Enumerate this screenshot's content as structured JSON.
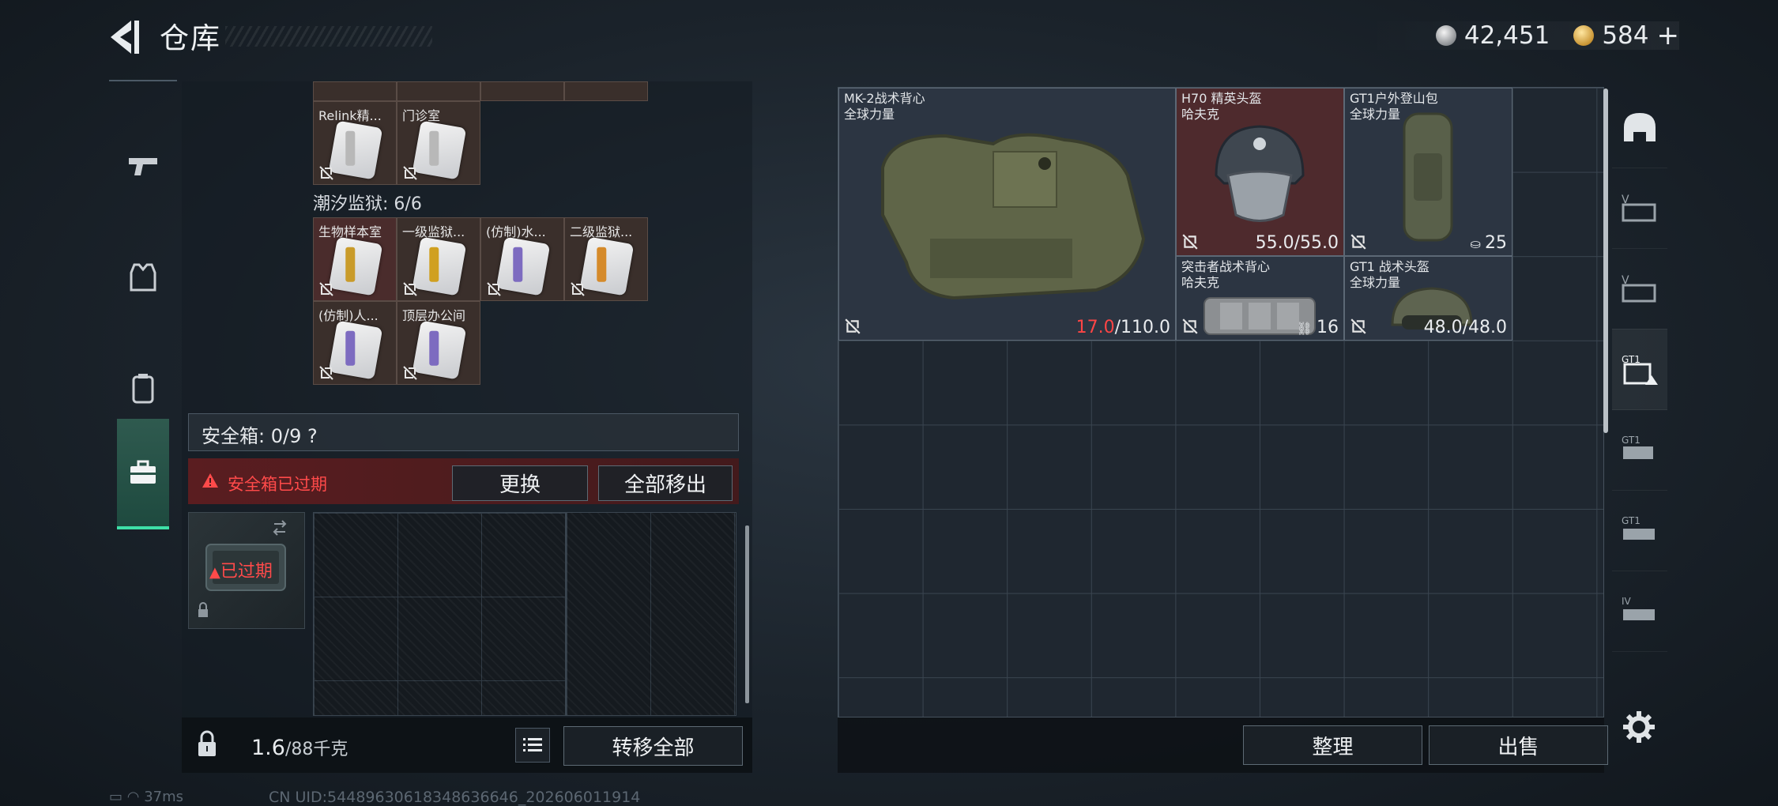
{
  "header": {
    "title": "仓库"
  },
  "currency": {
    "silver": "42,451",
    "gold": "584",
    "gold_add": "+"
  },
  "left_tabs": [
    "weapon-tab",
    "armor-tab",
    "backpack-tab",
    "safe-box-tab"
  ],
  "keys": {
    "top_row_labels": [
      "Relink精...",
      "门诊室"
    ],
    "section_title": "潮汐监狱: 6/6",
    "prison_cards": [
      {
        "label": "生物样本室",
        "color": "#c99b2a",
        "red": true
      },
      {
        "label": "一级监狱...",
        "color": "#d0a020",
        "red": false
      },
      {
        "label": "(仿制)水...",
        "color": "#7d6bc0",
        "red": false
      },
      {
        "label": "二级监狱...",
        "color": "#d58a2a",
        "red": false
      },
      {
        "label": "(仿制)人...",
        "color": "#7d6bc0",
        "red": false
      },
      {
        "label": "顶层办公间",
        "color": "#7d6bc0",
        "red": false
      }
    ]
  },
  "safe_box": {
    "label": "安全箱: 0/9  ?",
    "expired_warning": "安全箱已过期",
    "replace_button": "更换",
    "remove_all_button": "全部移出",
    "thumb_status": "已过期"
  },
  "left_footer": {
    "weight_value": "1.6",
    "weight_max": "/88千克",
    "transfer_all_button": "转移全部"
  },
  "stash_items": [
    {
      "name": "MK-2战术背心",
      "brand": "全球力量",
      "durability_current": "17.0",
      "durability_max": "/110.0",
      "low": true
    },
    {
      "name": "H70 精英头盔",
      "brand": "哈夫克",
      "durability_current": "55.0",
      "durability_max": "/55.0",
      "low": false
    },
    {
      "name": "GT1户外登山包",
      "brand": "全球力量",
      "count": "25"
    },
    {
      "name": "突击者战术背心",
      "brand": "哈夫克",
      "count": "16"
    },
    {
      "name": "GT1 战术头盔",
      "brand": "全球力量",
      "durability_current": "48.0",
      "durability_max": "/48.0",
      "low": false
    }
  ],
  "right_footer": {
    "organize_button": "整理",
    "sell_button": "出售"
  },
  "right_tabs": [
    "helmet-tab",
    "armor-v-tab",
    "armor-v2-tab",
    "gt1-helmet-tab",
    "gt1-pack-tab",
    "gt1-rig-tab",
    "armor-iv-tab"
  ],
  "status": {
    "ping": "37ms",
    "uid": "CN UID:5448963061834863664​6_202606011914"
  }
}
